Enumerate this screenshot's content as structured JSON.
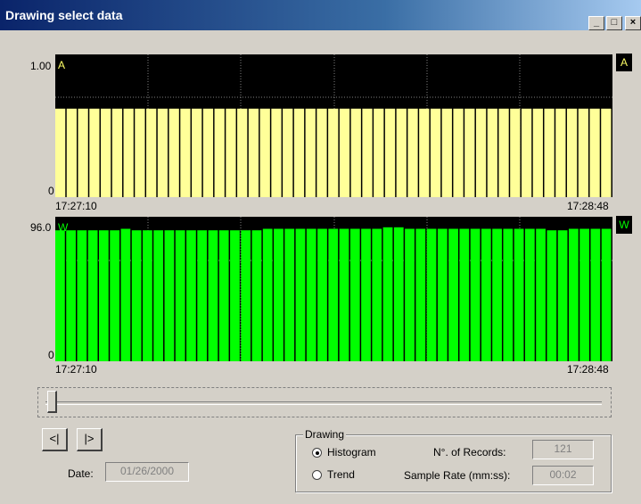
{
  "window": {
    "title": "Drawing select data",
    "controls": [
      "_",
      "□",
      "×"
    ]
  },
  "charts": [
    {
      "legend": "A",
      "ymax_label": "1.00",
      "ymin_label": "0",
      "start_time": "17:27:10",
      "end_time": "17:28:48",
      "color": "#ffff99",
      "text_color": "#ffff66"
    },
    {
      "legend": "W",
      "ymax_label": "96.0",
      "ymin_label": "0",
      "start_time": "17:27:10",
      "end_time": "17:28:48",
      "color": "#00ff00",
      "text_color": "#00ff00"
    }
  ],
  "chart_data": [
    {
      "type": "bar",
      "title": "",
      "series": [
        {
          "name": "A",
          "values": [
            0.62,
            0.62,
            0.62,
            0.62,
            0.62,
            0.62,
            0.62,
            0.62,
            0.62,
            0.62,
            0.62,
            0.62,
            0.62,
            0.62,
            0.62,
            0.62,
            0.62,
            0.62,
            0.62,
            0.62,
            0.62,
            0.62,
            0.62,
            0.62,
            0.62,
            0.62,
            0.62,
            0.62,
            0.62,
            0.62,
            0.62,
            0.62,
            0.62,
            0.62,
            0.62,
            0.62,
            0.62,
            0.62,
            0.62,
            0.62,
            0.62,
            0.62,
            0.62,
            0.62,
            0.62,
            0.62,
            0.62,
            0.62,
            0.62
          ]
        }
      ],
      "x_range": [
        "17:27:10",
        "17:28:48"
      ],
      "ylim": [
        0,
        1.0
      ],
      "grid": true
    },
    {
      "type": "bar",
      "title": "",
      "series": [
        {
          "name": "W",
          "values": [
            87,
            87,
            87,
            87,
            87,
            87,
            88,
            87,
            87,
            87,
            87,
            87,
            87,
            87,
            87,
            87,
            87,
            87,
            87,
            88,
            88,
            88,
            88,
            88,
            88,
            88,
            88,
            88,
            88,
            88,
            89,
            89,
            88,
            88,
            88,
            88,
            88,
            88,
            88,
            88,
            88,
            88,
            88,
            88,
            88,
            87,
            87,
            88,
            88,
            88,
            88
          ]
        }
      ],
      "x_range": [
        "17:27:10",
        "17:28:48"
      ],
      "ylim": [
        0,
        96.0
      ],
      "grid": true
    }
  ],
  "slider": {
    "position_fraction": 0.0
  },
  "nav": {
    "prev_label": "<|",
    "next_label": "|>"
  },
  "date": {
    "label": "Date:",
    "value": "01/26/2000"
  },
  "drawing": {
    "group_label": "Drawing",
    "options": [
      {
        "label": "Histogram",
        "selected": true
      },
      {
        "label": "Trend",
        "selected": false
      }
    ],
    "records_label": "N°. of Records:",
    "records_value": "121",
    "sample_rate_label": "Sample Rate (mm:ss):",
    "sample_rate_value": "00:02"
  }
}
